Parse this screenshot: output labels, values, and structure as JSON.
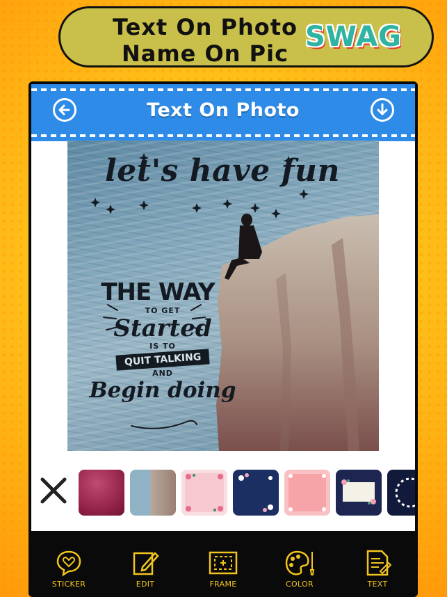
{
  "banner": {
    "line1": "Text On Photo",
    "line2": "Name On Pic",
    "badge": "SWAG"
  },
  "appbar": {
    "title": "Text On Photo",
    "back_icon": "arrow-left-circle-icon",
    "download_icon": "download-circle-icon",
    "background": "#2e8ce8"
  },
  "canvas": {
    "headline": "let's have fun",
    "quote": {
      "line1": "THE WAY",
      "line2": "TO GET",
      "line3": "Started",
      "line4": "IS TO",
      "line5": "QUIT TALKING",
      "line6": "AND",
      "line7": "Begin doing"
    }
  },
  "backgrounds": {
    "close_icon": "close-x-icon",
    "items": [
      {
        "name": "magenta-gradient"
      },
      {
        "name": "cliff-photo"
      },
      {
        "name": "pink-floral"
      },
      {
        "name": "navy-floral"
      },
      {
        "name": "coral-floral"
      },
      {
        "name": "navy-floral-banner"
      },
      {
        "name": "navy-floral-wreath"
      }
    ]
  },
  "toolbar": {
    "accent": "#f2c51e",
    "items": [
      {
        "label": "STICKER",
        "icon": "heart-chat-icon"
      },
      {
        "label": "EDIT",
        "icon": "edit-pencil-icon"
      },
      {
        "label": "FRAME",
        "icon": "frame-icon"
      },
      {
        "label": "COLOR",
        "icon": "palette-icon"
      },
      {
        "label": "TEXT",
        "icon": "text-document-icon"
      }
    ]
  }
}
